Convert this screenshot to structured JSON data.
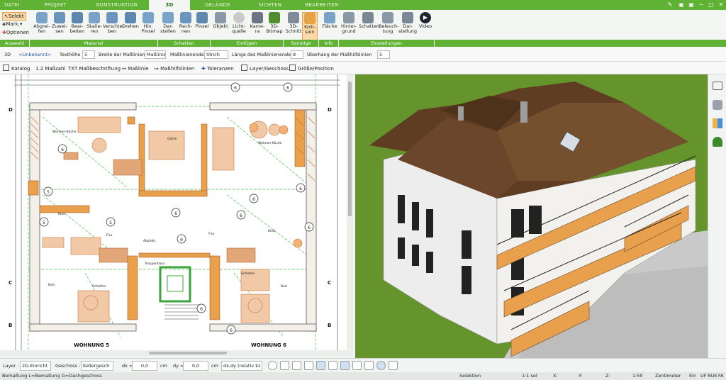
{
  "tabs": [
    "DATEI",
    "PROJEKT",
    "KONSTRUKTION",
    "3D",
    "GELÄNDE",
    "SICHTEN",
    "BEARBEITEN"
  ],
  "auswahl": {
    "selekt": "Selekt",
    "mark": "Mark.",
    "optionen": "Optionen",
    "group": "Auswahl"
  },
  "material": {
    "items": [
      "Abgrei-\nfen",
      "Zuwei-\nsen",
      "Bear-\nbeiten",
      "Skalie-\nren",
      "Verschie-\nben",
      "Drehen",
      "Hin.\nPinsel"
    ],
    "group": "Material"
  },
  "schatten": {
    "items": [
      "Dar-\nstellen",
      "Rech-\nnen",
      "Pinsel"
    ],
    "group": "Schatten"
  },
  "einfuegen": {
    "items": [
      "Objekt",
      "Licht-\nquelle",
      "Kame-\nra",
      "3D-\nBitmap"
    ],
    "group": "Einfügen"
  },
  "sonstige": {
    "items": [
      "3D-\nSchnitt",
      "Kolli-\nsion"
    ],
    "group": "Sonstige"
  },
  "info": {
    "items": [
      "Fläche"
    ],
    "group": "Info"
  },
  "einstellungen": {
    "items": [
      "Hinter-\ngrund",
      "Schatten",
      "Beleuch-\ntung",
      "Dar-\nstellung",
      "Video"
    ],
    "group": "Einstellungen"
  },
  "toolrow": {
    "mode": "3D",
    "type": "<Unbekannt>",
    "texthoehe_label": "Texthöhe",
    "texthoehe": "5",
    "breite_label": "Breite der Maßlinien",
    "breite": "Maßlinie",
    "ende_label": "Maßlinienende",
    "ende": "Strich",
    "laenge_label": "Länge des Maßlinienendes",
    "laenge": "8",
    "ueberhang_label": "Überhang der Maßhilfslinien",
    "ueberhang": "5"
  },
  "proptabs": [
    "Katalog",
    "1.2 Maßzahl",
    "TXT Maßbeschriftung",
    "Maßlinie",
    "Maßhilfslinien",
    "Toleranzen",
    "Layer/Geschoss",
    "Größe/Position"
  ],
  "plan": {
    "rooms": [
      "Wohnen-Küche",
      "Gäste",
      "Kind",
      "Flur",
      "Bad",
      "Schlafen",
      "Abstellr.",
      "Treppenhaus",
      "Wohnen-Küche",
      "Kind",
      "Flur",
      "Bad",
      "Schlafen"
    ],
    "wohnung_left": "WOHNUNG 5",
    "wohnung_right": "WOHNUNG 6",
    "markers": [
      "D",
      "D",
      "C",
      "C",
      "B",
      "B"
    ]
  },
  "bottombar": {
    "layer_label": "Layer :",
    "layer": "2D-Einricht",
    "geschoss_label": "Geschoss :",
    "geschoss": "Kellergesch",
    "dx_label": "dx =",
    "dx": "0,0",
    "dx_unit": "cm",
    "dy_label": "dy =",
    "dy": "0,0",
    "dy_unit": "cm",
    "mode": "dx,dy (relativ kz"
  },
  "statusbar": {
    "left": "Bemaßung L=Bemaßung G=Dachgeschoss",
    "selektion": "Selektion",
    "scale1": "1:1 sel",
    "x": "X:",
    "y": "Y:",
    "z": "Z:",
    "scale2": "1:50",
    "unit": "Zentimeter",
    "ein": "Ein",
    "uf": "UF",
    "nue": "NUE",
    "fa": "FA"
  },
  "colors": {
    "green": "#5fb234",
    "orange": "#e8a04c",
    "wall": "#d87a3d"
  }
}
